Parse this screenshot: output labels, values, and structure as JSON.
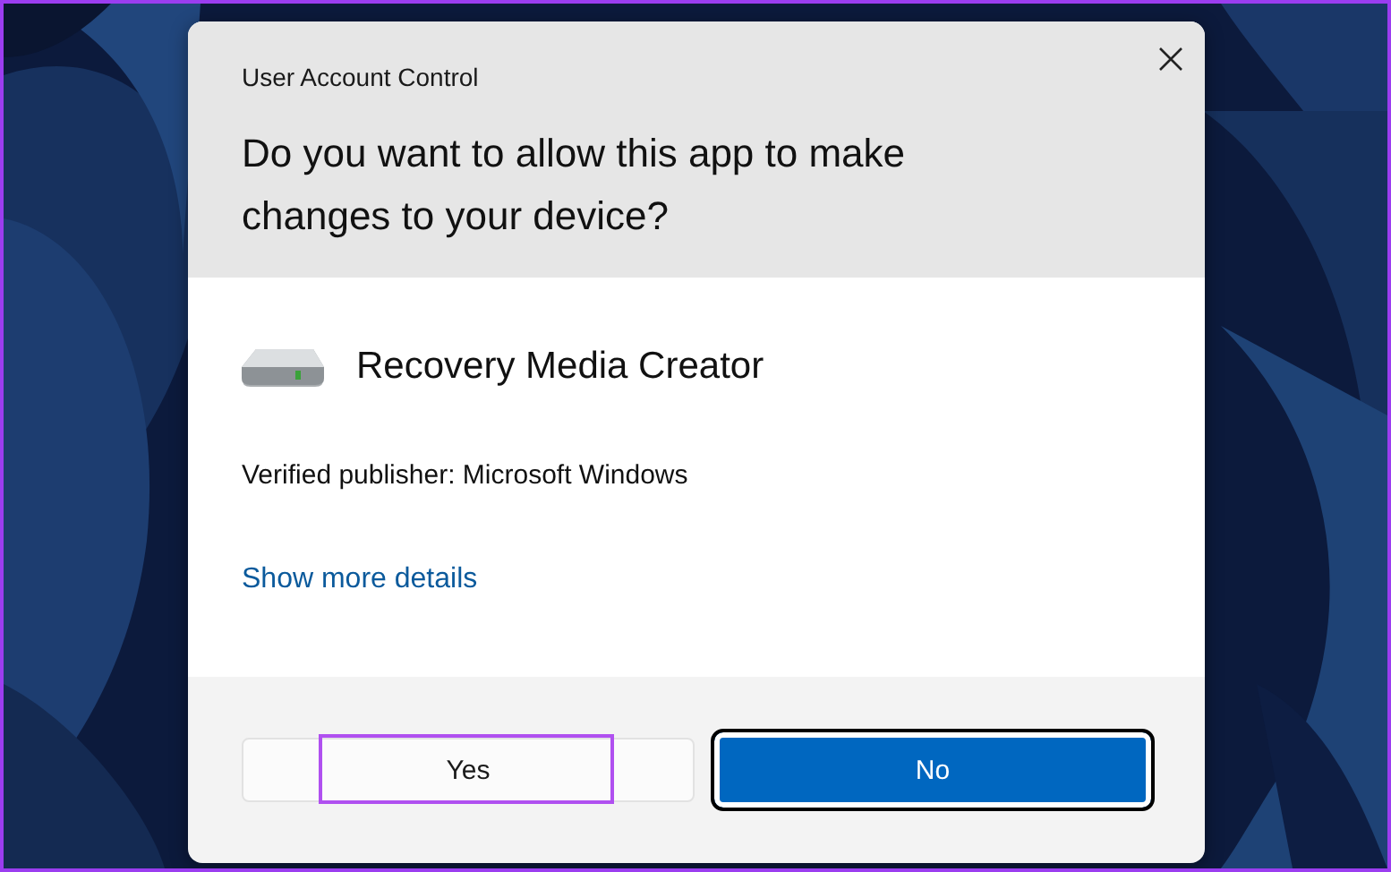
{
  "dialog": {
    "title": "User Account Control",
    "question": "Do you want to allow this app to make changes to your device?",
    "app_name": "Recovery Media Creator",
    "publisher": "Verified publisher: Microsoft Windows",
    "details_link": "Show more details"
  },
  "buttons": [
    {
      "label": "Yes",
      "kind": "secondary",
      "focused": false,
      "highlighted": true
    },
    {
      "label": "No",
      "kind": "primary",
      "focused": true,
      "highlighted": false
    }
  ]
}
